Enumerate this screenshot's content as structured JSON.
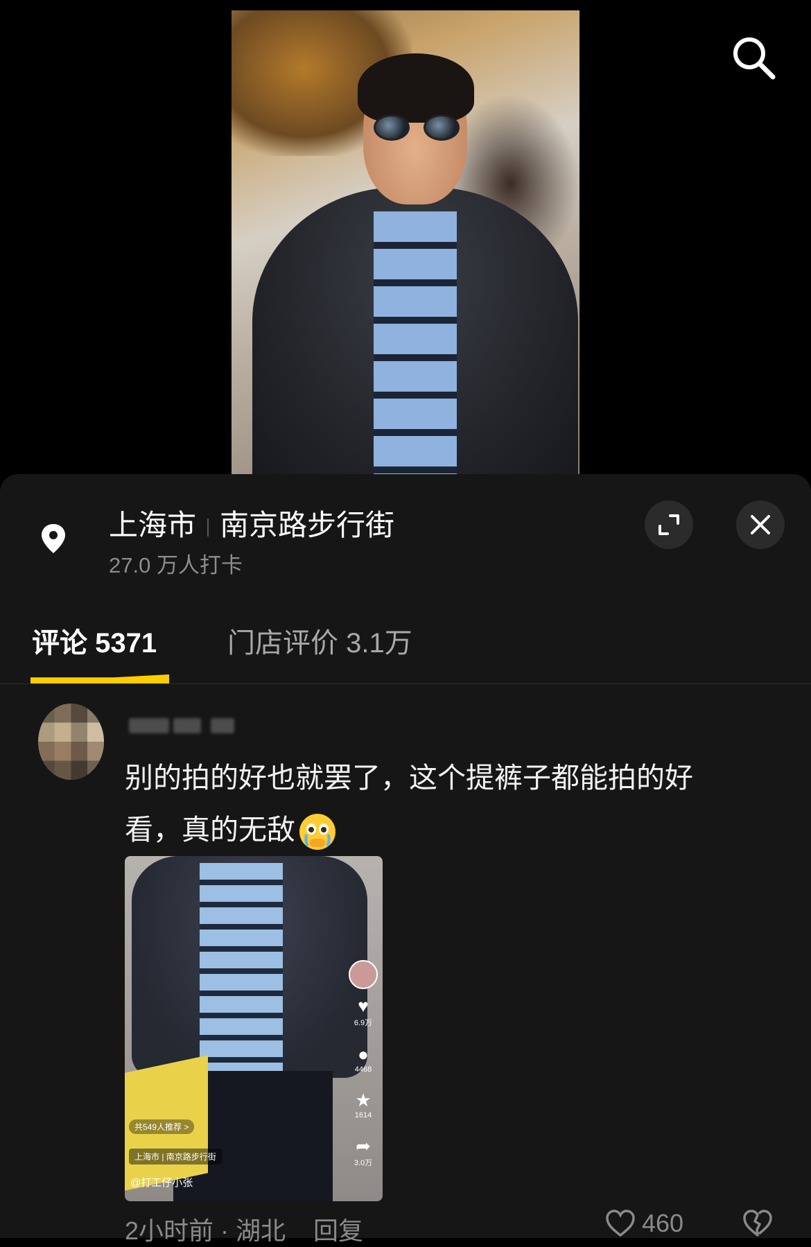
{
  "header": {
    "search_icon": "search-icon"
  },
  "location": {
    "city": "上海市",
    "place": "南京路步行街",
    "checkins": "27.0 万人打卡",
    "pin_icon": "location-pin-icon",
    "expand_icon": "expand-icon",
    "close_icon": "close-icon"
  },
  "tabs": [
    {
      "label": "评论",
      "count": "5371",
      "active": true
    },
    {
      "label": "门店评价",
      "count": "3.1万",
      "active": false
    }
  ],
  "colors": {
    "accent": "#ffcd00",
    "sheet_bg": "#161616",
    "muted": "#8a8a8a"
  },
  "comment": {
    "text": "别的拍的好也就罢了，这个提裤子都能拍的好看，真的无敌",
    "emoji": "crying-face-emoji",
    "time_location": "2小时前 · 湖北",
    "reply_label": "回复",
    "like_count": "460",
    "thumbnail": {
      "likes": "6.9万",
      "comments": "4468",
      "favorites": "1614",
      "shares": "3.0万",
      "recommend": "共549人推荐 >",
      "location": "上海市 | 南京路步行街",
      "user": "@打工仔小张"
    }
  }
}
